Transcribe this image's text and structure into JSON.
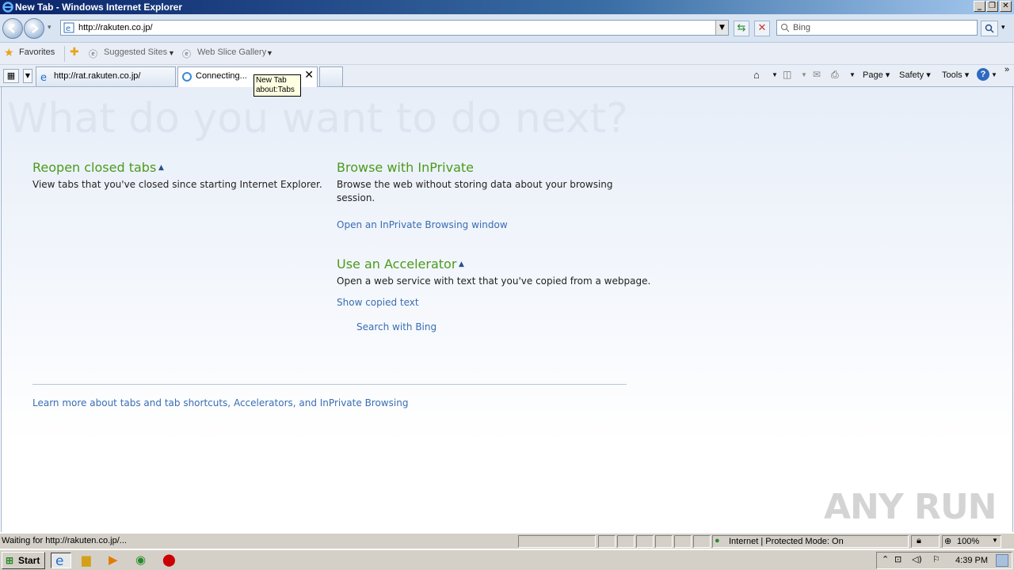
{
  "window": {
    "title": "New Tab - Windows Internet Explorer",
    "controls": [
      "_",
      "❐",
      "✕"
    ]
  },
  "nav": {
    "address": "http://rakuten.co.jp/",
    "search_placeholder": "Bing"
  },
  "favorites_bar": {
    "favorites_label": "Favorites",
    "suggested_sites": "Suggested Sites",
    "web_slice_gallery": "Web Slice Gallery"
  },
  "tabs": [
    {
      "label": "http://rat.rakuten.co.jp/"
    },
    {
      "label": "Connecting..."
    }
  ],
  "tooltip": {
    "line1": "New Tab",
    "line2": "about:Tabs"
  },
  "command_bar": {
    "page": "Page",
    "safety": "Safety",
    "tools": "Tools"
  },
  "newtab": {
    "heading": "What do you want to do next?",
    "reopen": {
      "title": "Reopen closed tabs",
      "desc": "View tabs that you've closed since starting Internet Explorer."
    },
    "inprivate": {
      "title": "Browse with InPrivate",
      "desc1": "Browse the web without storing data about your browsing",
      "desc2": "session.",
      "link": "Open an InPrivate Browsing window"
    },
    "accelerator": {
      "title": "Use an Accelerator",
      "desc": "Open a web service with text that you've copied from a webpage.",
      "show_link": "Show copied text",
      "search_link": "Search with Bing"
    },
    "learn_more": "Learn more about tabs and tab shortcuts, Accelerators, and InPrivate Browsing"
  },
  "watermark": "ANY RUN",
  "status": {
    "text": "Waiting for http://rakuten.co.jp/...",
    "zone": "Internet | Protected Mode: On",
    "zoom": "100%"
  },
  "taskbar": {
    "start": "Start",
    "clock": "4:39 PM"
  },
  "colors": {
    "accent_green": "#4c9a1c",
    "link_blue": "#3a6db3"
  }
}
